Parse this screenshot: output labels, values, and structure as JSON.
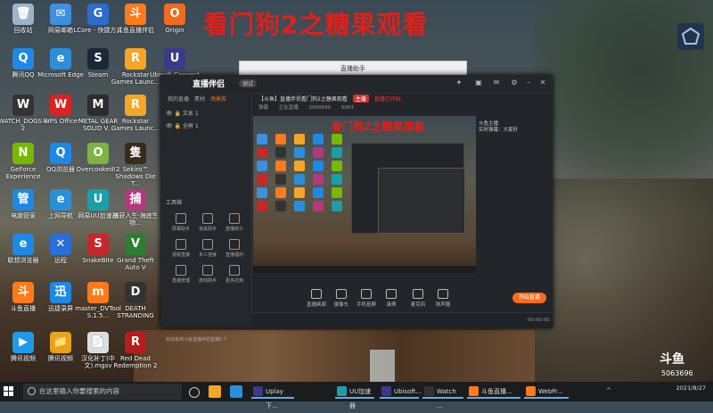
{
  "banner_title": "看门狗2之糖果观看",
  "desktop_icons": [
    {
      "label": "回收站",
      "color": "#9fb3c8",
      "glyph": "🗑"
    },
    {
      "label": "网易邮箱",
      "color": "#3d8fe0",
      "glyph": "✉"
    },
    {
      "label": "LCore - 快捷方式",
      "color": "#2b6ccf",
      "glyph": "G"
    },
    {
      "label": "斗鱼直播伴侣",
      "color": "#ff7a1a",
      "glyph": "斗"
    },
    {
      "label": "Origin",
      "color": "#f26b1d",
      "glyph": "O"
    },
    {
      "label": "腾讯QQ",
      "color": "#1e88e5",
      "glyph": "Q"
    },
    {
      "label": "Microsoft Edge",
      "color": "#2a8fd8",
      "glyph": "e"
    },
    {
      "label": "Steam",
      "color": "#1b2838",
      "glyph": "S"
    },
    {
      "label": "Rockstar Games Launc...",
      "color": "#f5a623",
      "glyph": "R"
    },
    {
      "label": "Ubisoft Connect",
      "color": "#3a3a8a",
      "glyph": "U"
    },
    {
      "label": "WATCH_DOGS® 2",
      "color": "#333",
      "glyph": "W"
    },
    {
      "label": "WPS Office",
      "color": "#d22",
      "glyph": "W"
    },
    {
      "label": "METAL GEAR SOLID V...",
      "color": "#2c2c2c",
      "glyph": "M"
    },
    {
      "label": "Rockstar Games Launc...",
      "color": "#f5a623",
      "glyph": "R"
    },
    {
      "label": "GeForce Experience",
      "color": "#76b900",
      "glyph": "N"
    },
    {
      "label": "QQ浏览器",
      "color": "#1e88e5",
      "glyph": "Q"
    },
    {
      "label": "Overcooked!2",
      "color": "#7cb342",
      "glyph": "O"
    },
    {
      "label": "Sekiro™ Shadows Die T...",
      "color": "#3a2a1a",
      "glyph": "隻"
    },
    {
      "label": "电脑管家",
      "color": "#1e88e5",
      "glyph": "管"
    },
    {
      "label": "上网导航",
      "color": "#2a8fd8",
      "glyph": "e"
    },
    {
      "label": "网易UU加速器",
      "color": "#1a9fa8",
      "glyph": "U"
    },
    {
      "label": "捕获人生·海底生物...",
      "color": "#b3397f",
      "glyph": "捕"
    },
    {
      "label": "联想浏览器",
      "color": "#1e88e5",
      "glyph": "e"
    },
    {
      "label": "远程",
      "color": "#2a6fd8",
      "glyph": "✕"
    },
    {
      "label": "SnakeBite",
      "color": "#c62828",
      "glyph": "S"
    },
    {
      "label": "Grand Theft Auto V",
      "color": "#2e7d32",
      "glyph": "V"
    },
    {
      "label": "斗鱼直播",
      "color": "#ff7a1a",
      "glyph": "斗"
    },
    {
      "label": "迅捷录屏",
      "color": "#1e88e5",
      "glyph": "迅"
    },
    {
      "label": "master_DVTool S.1.5...",
      "color": "#ff7a1a",
      "glyph": "m"
    },
    {
      "label": "DEATH STRANDING",
      "color": "#333",
      "glyph": "D"
    },
    {
      "label": "腾讯视频",
      "color": "#1e9be8",
      "glyph": "▶"
    },
    {
      "label": "腾讯视频",
      "color": "#e8a21e",
      "glyph": "📁"
    },
    {
      "label": "汉化补丁(中文).mgsv",
      "color": "#ddd",
      "glyph": "📄"
    },
    {
      "label": "Red Dead Redemption 2",
      "color": "#b71c1c",
      "glyph": "R"
    }
  ],
  "app": {
    "name": "直播伴侣",
    "version": "测试",
    "left_tabs": [
      "我的直播",
      "素材",
      "场景库"
    ],
    "active_tab": "场景库",
    "scenes": [
      "文本 1",
      "全屏 1"
    ],
    "tools_heading": "工具箱",
    "tools": [
      "屏幕助手",
      "道具助手",
      "直播统计",
      "视频直播",
      "多人连接",
      "直播福利",
      "直播管理",
      "游戏助手",
      "更多应用"
    ],
    "bottom_tip": "欢迎来到斗鱼直播伴侣直播5.7",
    "stream_title": "【斗鱼】直播伴侣看门狗2之糖果观看",
    "stream_tag": "主播",
    "stream_status": "直播已开始",
    "meta": [
      "弹幕",
      "正在直播",
      "2069690",
      "5063"
    ],
    "right_info": [
      "斗鱼主播",
      "实时弹幕：大家好"
    ],
    "preview_banner": "看门狗2之糖果观看",
    "controls": [
      "直播画面",
      "摄像头",
      "手机投屏",
      "录屏",
      "麦克风",
      "扬声器"
    ],
    "start_label": "开始直播",
    "timer": "00:00:00"
  },
  "bg_window_text": "直播助手",
  "watermark": "斗鱼",
  "room_id": "5063696",
  "taskbar": {
    "search_placeholder": "在这里输入你要搜索的内容",
    "apps": [
      "Uplay下...",
      "UU加速器",
      "Ubisoft...",
      "Watch ...",
      "斗鱼直播...",
      "WebFr..."
    ],
    "time": "2021/8/27",
    "tray": "^"
  }
}
